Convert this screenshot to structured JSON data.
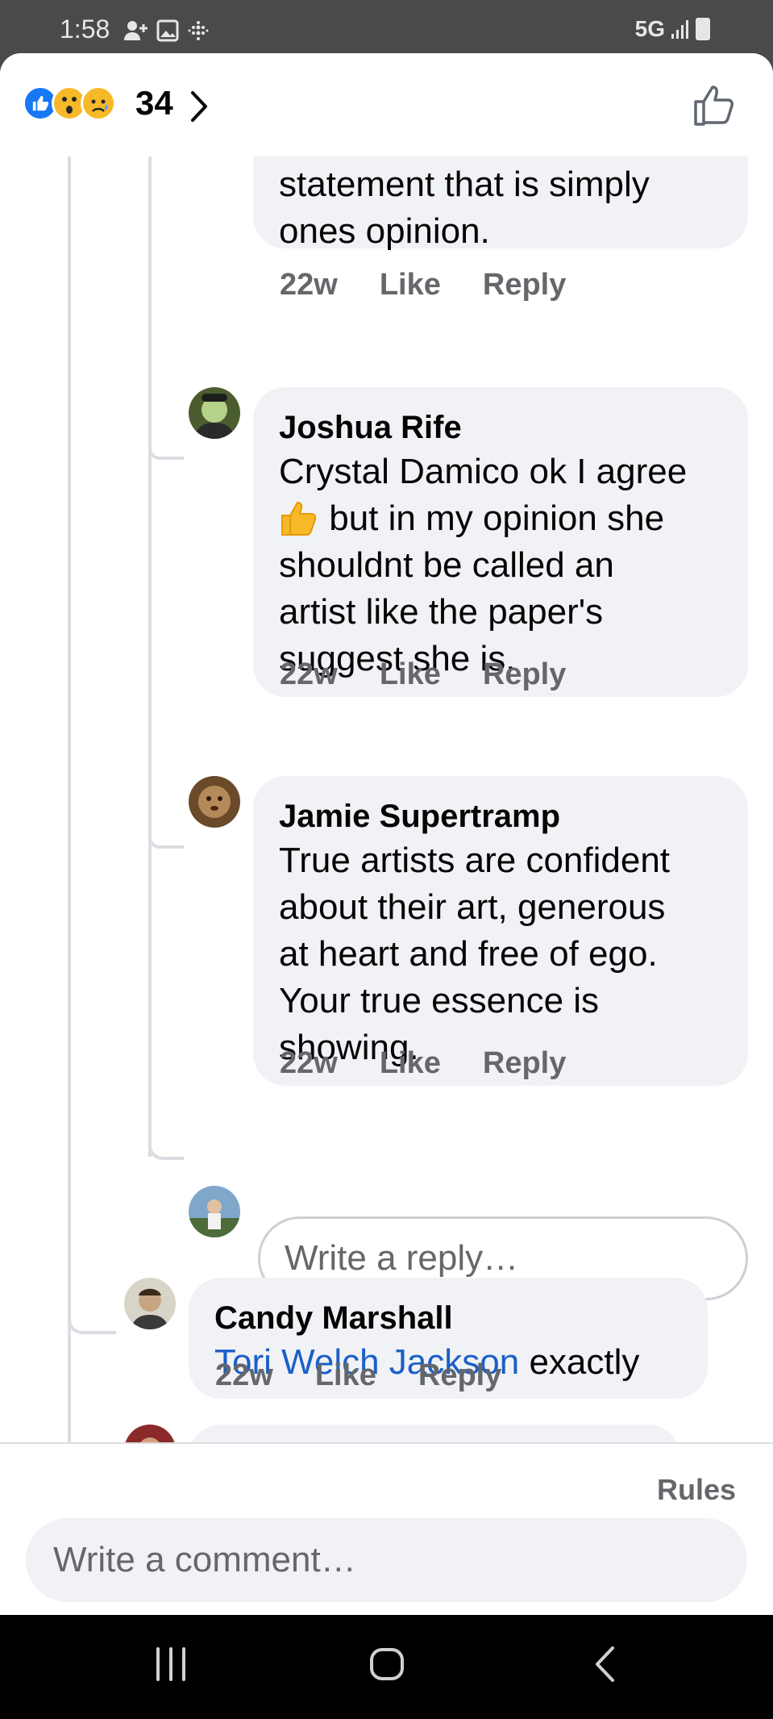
{
  "status_bar": {
    "time": "1:58",
    "network": "5G"
  },
  "header": {
    "reaction_icons": [
      "like-reaction",
      "wow-reaction",
      "sad-reaction"
    ],
    "reaction_count": "34"
  },
  "comments": [
    {
      "author": "",
      "text_lines": [
        "statement that is simply",
        "ones opinion."
      ],
      "time": "22w",
      "like_label": "Like",
      "reply_label": "Reply"
    },
    {
      "author": "Joshua Rife",
      "text_line1": "Crystal Damico ok I agree",
      "text_line2": " but in my opinion she",
      "text_rest": [
        "shouldnt be called an",
        "artist like the paper's",
        "suggest she is."
      ],
      "time": "22w",
      "like_label": "Like",
      "reply_label": "Reply"
    },
    {
      "author": "Jamie Supertramp",
      "text_lines": [
        "True artists are confident",
        "about their art, generous",
        "at heart and free of ego.",
        "Your true essence is",
        "showing."
      ],
      "time": "22w",
      "like_label": "Like",
      "reply_label": "Reply"
    },
    {
      "author": "Candy Marshall",
      "mention": "Tori Welch Jackson",
      "text": " exactly",
      "time": "22w",
      "like_label": "Like",
      "reply_label": "Reply"
    }
  ],
  "reply_input": {
    "placeholder": "Write a reply…"
  },
  "composer": {
    "rules_label": "Rules",
    "placeholder": "Write a comment…"
  },
  "colors": {
    "accent": "#1877f2",
    "mention": "#1b5fc7",
    "bubble": "#f0f2f5",
    "muted_text": "#65676b"
  }
}
